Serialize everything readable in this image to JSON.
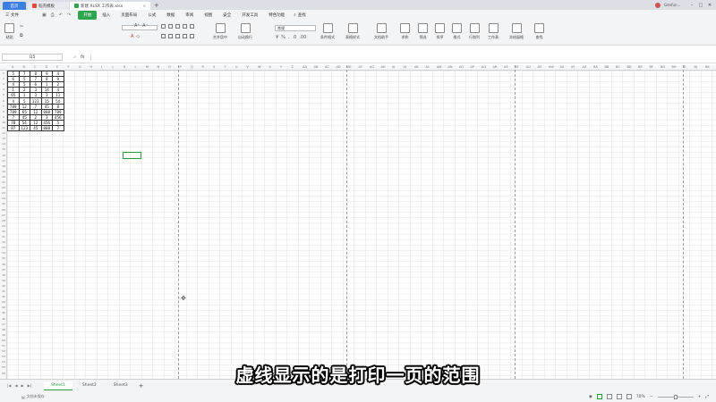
{
  "titlebar": {
    "tabs": [
      {
        "label": "首页",
        "color": "#3b7fe0"
      },
      {
        "label": "稻壳模板",
        "color": "#e34b3b"
      },
      {
        "label": "新建 XLSX 工作表.xlsx",
        "color": "#2fa44f"
      }
    ],
    "new_tab": "+",
    "user": "Genfun..."
  },
  "menu": {
    "file": "文件",
    "tabs": [
      "开始",
      "插入",
      "页面布局",
      "公式",
      "数据",
      "审阅",
      "视图",
      "安全",
      "开发工具",
      "特色功能"
    ],
    "active_tab": "开始",
    "search": "查找"
  },
  "toolbar": {
    "paste": "粘贴",
    "merge": "合并居中",
    "wrap": "自动换行",
    "number_format": "常规",
    "cond_format": "条件格式",
    "table_style": "表格样式",
    "doc_helper": "文档助手",
    "sum": "求和",
    "filter": "筛选",
    "sort": "排序",
    "format": "格式",
    "rowcol": "行和列",
    "worksheet": "工作表",
    "freeze": "冻结窗格",
    "more": "查找"
  },
  "formula_bar": {
    "cell_ref": "I15",
    "fx": "fx"
  },
  "table": [
    [
      "5",
      "7",
      "8",
      "9",
      "4"
    ],
    [
      "6",
      "5",
      "7",
      "8",
      "9"
    ],
    [
      "4",
      "5",
      "6",
      "1",
      "2"
    ],
    [
      "1",
      "2",
      "3",
      "14",
      "4"
    ],
    [
      "65",
      "1",
      "3",
      "3",
      "11"
    ],
    [
      "4",
      "5",
      "123",
      "15",
      "54"
    ],
    [
      "789",
      "12",
      "7",
      "45",
      "8"
    ],
    [
      "789",
      "65",
      "12",
      "888",
      "789"
    ],
    [
      "7",
      "45",
      "2",
      "3",
      "456"
    ],
    [
      "78",
      "54",
      "12",
      "456",
      "5"
    ],
    [
      "87",
      "123",
      "45",
      "888",
      "7"
    ]
  ],
  "sheets": {
    "tabs": [
      "Sheet1",
      "Sheet2",
      "Sheet3"
    ],
    "active": "Sheet1",
    "add": "+"
  },
  "status": {
    "left": "文档未保存",
    "zoom": "70%"
  },
  "subtitle": "虚线显示的是打印一页的范围"
}
